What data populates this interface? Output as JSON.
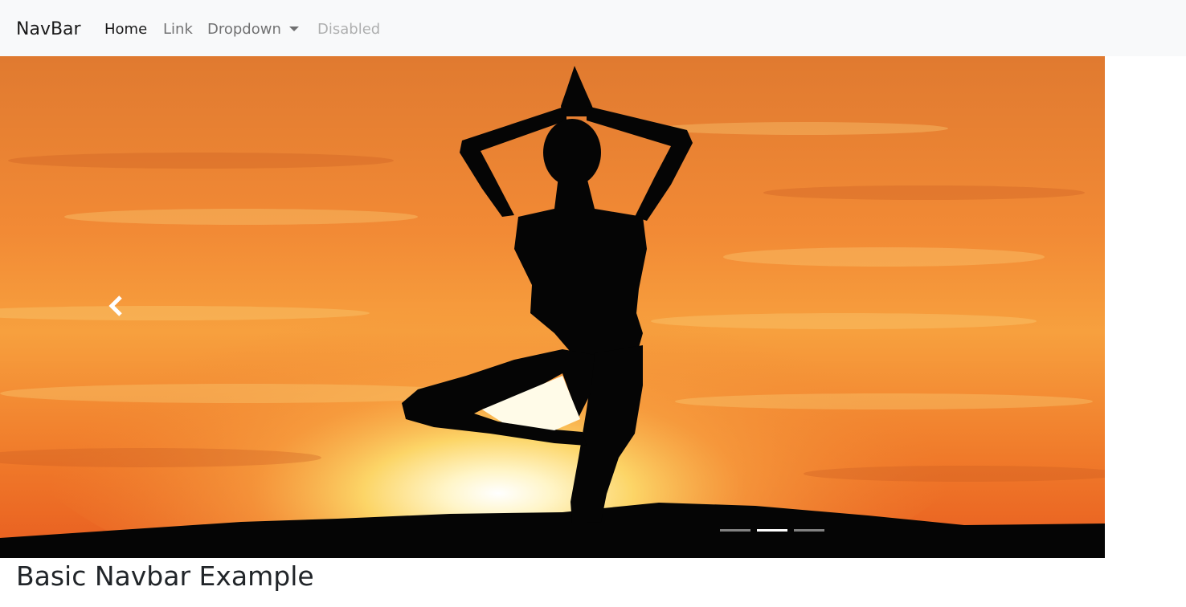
{
  "navbar": {
    "brand": "NavBar",
    "items": [
      {
        "label": "Home",
        "state": "active"
      },
      {
        "label": "Link",
        "state": "default"
      },
      {
        "label": "Dropdown",
        "state": "default",
        "icon": "caret-down-icon"
      },
      {
        "label": "Disabled",
        "state": "disabled"
      }
    ]
  },
  "carousel": {
    "slide_image": "yoga-silhouette-sunset",
    "prev_icon": "chevron-left-icon",
    "indicators_count": 3,
    "active_indicator": 2
  },
  "content": {
    "heading": "Basic Navbar Example"
  },
  "colors": {
    "navbar_bg": "#f8f9fa",
    "sky_orange": "#f08030",
    "silhouette": "#050505"
  }
}
